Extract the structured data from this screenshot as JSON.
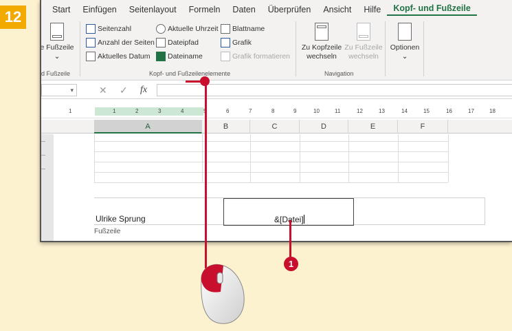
{
  "step_number": "12",
  "callout_number": "1",
  "tabs": [
    "Start",
    "Einfügen",
    "Seitenlayout",
    "Formeln",
    "Daten",
    "Überprüfen",
    "Ansicht",
    "Hilfe",
    "Kopf- und Fußzeile"
  ],
  "active_tab_index": 8,
  "ribbon": {
    "hf_group": {
      "button": "e Fußzeile",
      "label": "d Fußzeile"
    },
    "elements_group": {
      "label": "Kopf- und Fußzeilenelemente",
      "items": [
        "Seitenzahl",
        "Anzahl der Seiten",
        "Aktuelles Datum",
        "Aktuelle Uhrzeit",
        "Dateipfad",
        "Dateiname",
        "Blattname",
        "Grafik",
        "Grafik formatieren"
      ]
    },
    "navigation_group": {
      "label": "Navigation",
      "to_header": [
        "Zu Kopfzeile",
        "wechseln"
      ],
      "to_footer": [
        "Zu Fußzeile",
        "wechseln"
      ]
    },
    "options_label": "Optionen"
  },
  "formula_bar": {
    "fx": "fx",
    "cancel": "✕",
    "confirm": "✓"
  },
  "ruler_numbers": [
    "1",
    "1",
    "2",
    "3",
    "4",
    "5",
    "6",
    "7",
    "8",
    "9",
    "10",
    "11",
    "12",
    "13",
    "14",
    "15",
    "16",
    "17",
    "18"
  ],
  "columns": [
    "A",
    "B",
    "C",
    "D",
    "E",
    "F"
  ],
  "footer": {
    "left_text": "Ulrike Sprung",
    "center_text": "&[Datei]",
    "area_label": "Fußzeile"
  },
  "colors": {
    "accent": "#217346",
    "annotation": "#c8102e",
    "badge": "#f2a900"
  }
}
